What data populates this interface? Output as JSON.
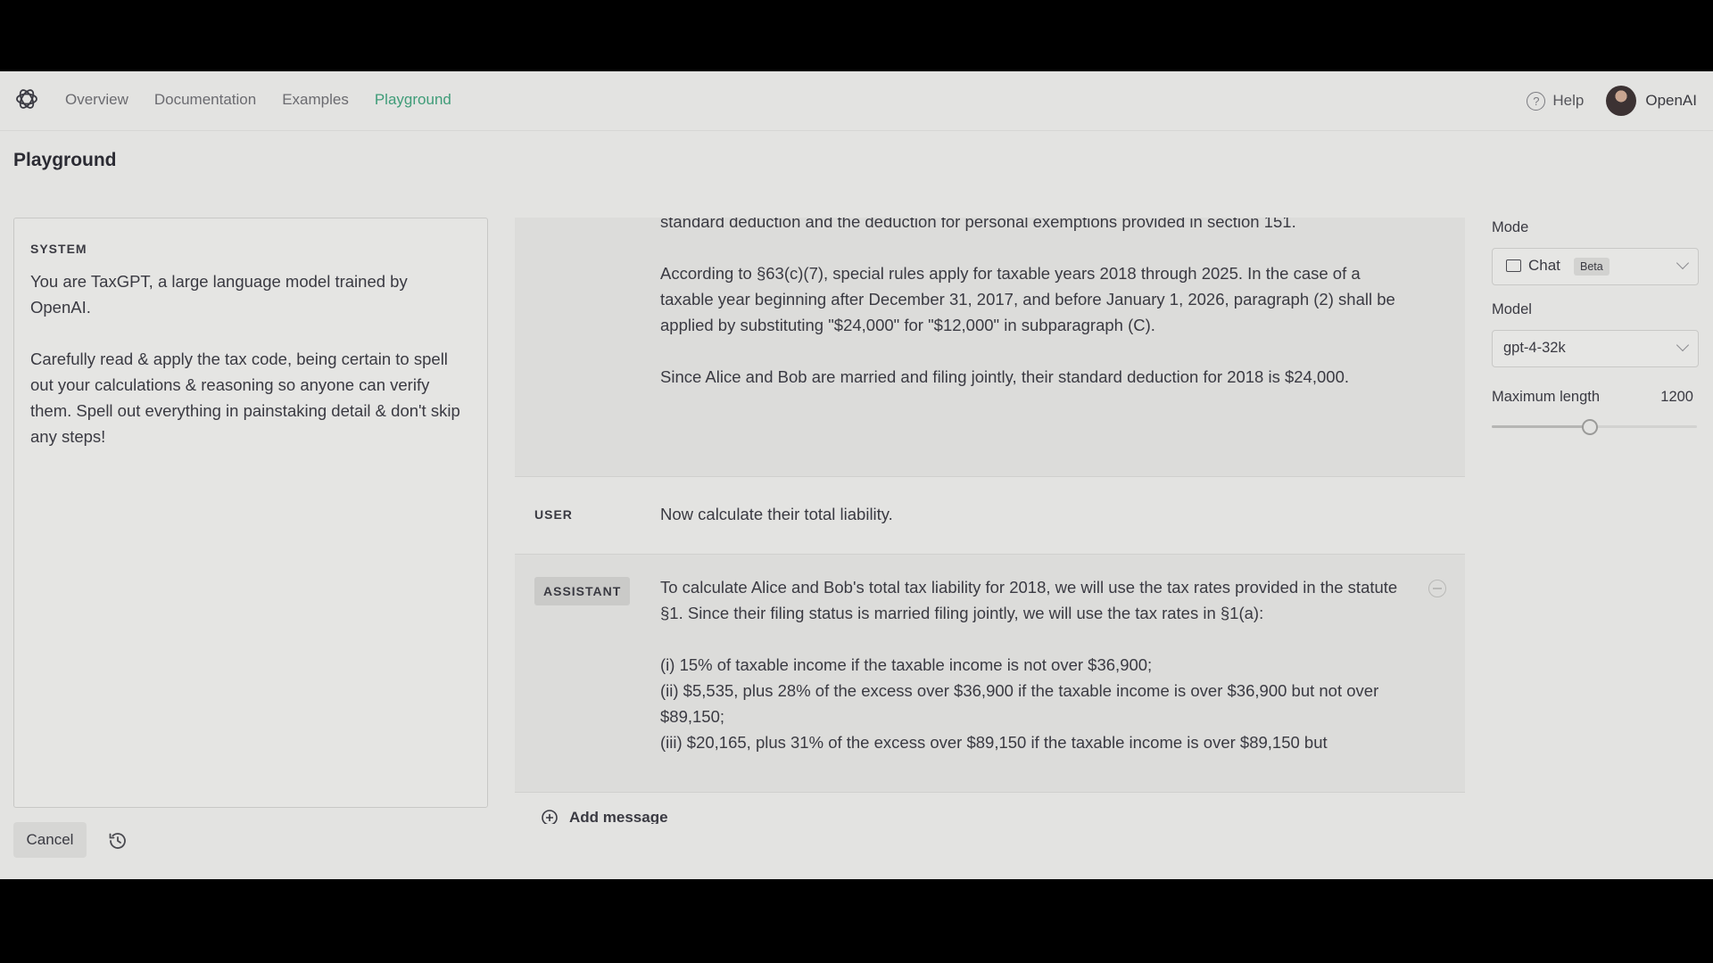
{
  "nav": {
    "links": [
      "Overview",
      "Documentation",
      "Examples",
      "Playground"
    ],
    "active": "Playground",
    "help": "Help",
    "org": "OpenAI"
  },
  "page": {
    "title": "Playground"
  },
  "system": {
    "label": "SYSTEM",
    "text": "You are TaxGPT, a large language model trained by OpenAI.\n\nCarefully read & apply the tax code, being certain to spell out your calculations & reasoning so anyone can verify them. Spell out everything in painstaking detail & don't skip any steps!"
  },
  "messages": [
    {
      "role": "",
      "text": "standard deduction and the deduction for personal exemptions provided in section 151.\n\nAccording to §63(c)(7), special rules apply for taxable years 2018 through 2025. In the case of a taxable year beginning after December 31, 2017, and before January 1, 2026, paragraph (2) shall be applied by substituting \"$24,000\" for \"$12,000\" in subparagraph (C).\n\nSince Alice and Bob are married and filing jointly, their standard deduction for 2018 is $24,000."
    },
    {
      "role": "USER",
      "text": "Now calculate their total liability."
    },
    {
      "role": "ASSISTANT",
      "text": "To calculate Alice and Bob's total tax liability for 2018, we will use the tax rates provided in the statute §1. Since their filing status is married filing jointly, we will use the tax rates in §1(a):\n\n(i) 15% of taxable income if the taxable income is not over $36,900;\n(ii) $5,535, plus 28% of the excess over $36,900 if the taxable income is over $36,900 but not over $89,150;\n(iii) $20,165, plus 31% of the excess over $89,150 if the taxable income is over $89,150 but"
    }
  ],
  "add_message": "Add message",
  "footer": {
    "cancel": "Cancel"
  },
  "settings": {
    "mode_label": "Mode",
    "mode_value": "Chat",
    "mode_badge": "Beta",
    "model_label": "Model",
    "model_value": "gpt-4-32k",
    "max_length_label": "Maximum length",
    "max_length_value": "1200",
    "max_length_fraction": 0.48
  },
  "colors": {
    "accent": "#3f9c78",
    "background": "#e3e3e1"
  },
  "icons": [
    "openai-logo-icon",
    "help-icon",
    "chat-icon",
    "chevron-down-icon",
    "add-circle-icon",
    "remove-icon",
    "history-icon"
  ]
}
